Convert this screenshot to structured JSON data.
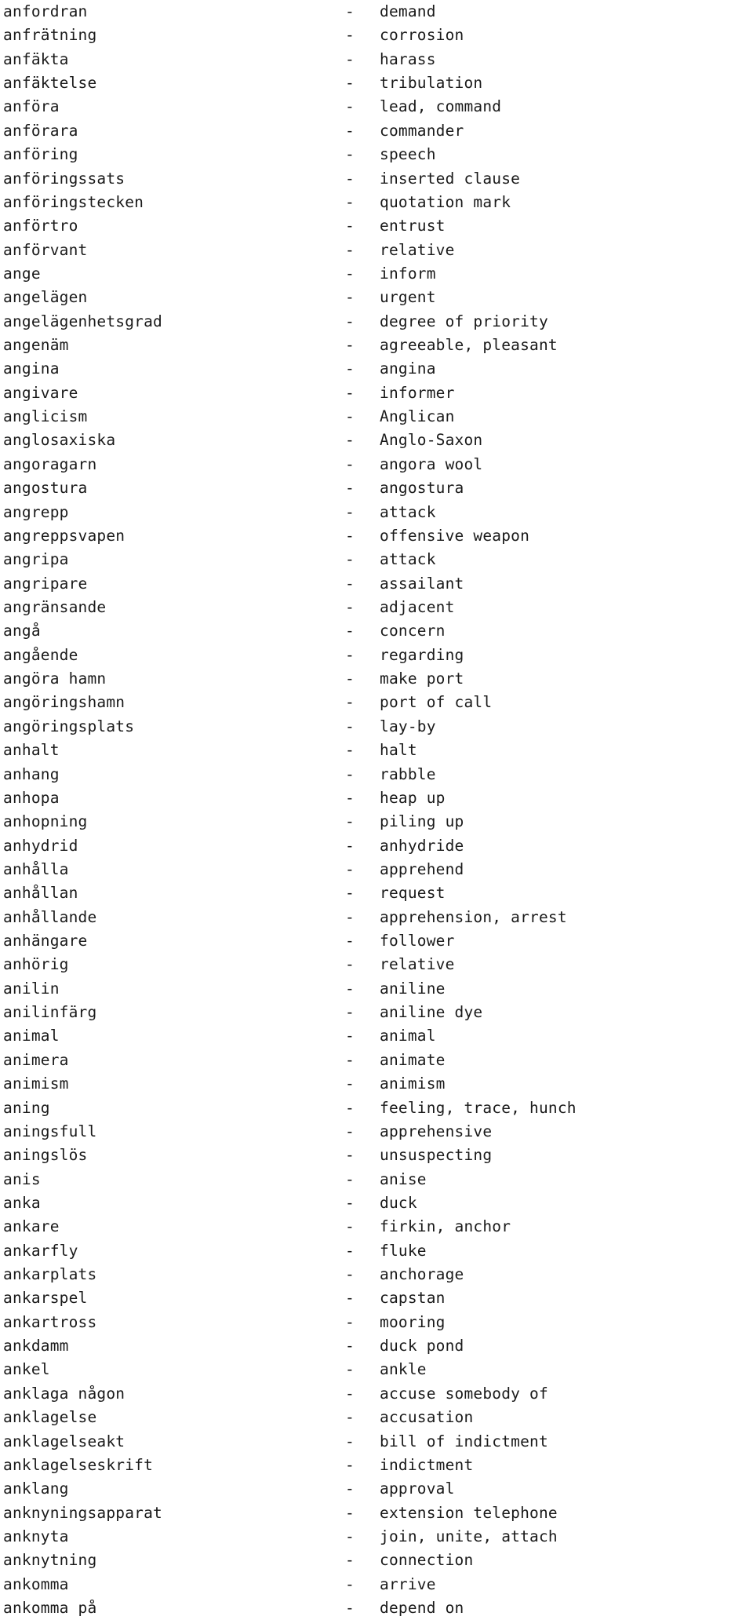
{
  "document": {
    "type": "bilingual-dictionary-page",
    "source_language": "Swedish",
    "target_language": "English",
    "separator": "-",
    "text_color": "#1a1a1a",
    "background_color": "#ffffff",
    "entries": [
      {
        "term": "anfordran",
        "gloss": "demand"
      },
      {
        "term": "anfrätning",
        "gloss": "corrosion"
      },
      {
        "term": "anfäkta",
        "gloss": "harass"
      },
      {
        "term": "anfäktelse",
        "gloss": "tribulation"
      },
      {
        "term": "anföra",
        "gloss": "lead, command"
      },
      {
        "term": "anförara",
        "gloss": "commander"
      },
      {
        "term": "anföring",
        "gloss": "speech"
      },
      {
        "term": "anföringssats",
        "gloss": "inserted clause"
      },
      {
        "term": "anföringstecken",
        "gloss": "quotation mark"
      },
      {
        "term": "anförtro",
        "gloss": "entrust"
      },
      {
        "term": "anförvant",
        "gloss": "relative"
      },
      {
        "term": "ange",
        "gloss": "inform"
      },
      {
        "term": "angelägen",
        "gloss": "urgent"
      },
      {
        "term": "angelägenhetsgrad",
        "gloss": "degree of priority"
      },
      {
        "term": "angenäm",
        "gloss": "agreeable, pleasant"
      },
      {
        "term": "angina",
        "gloss": "angina"
      },
      {
        "term": "angivare",
        "gloss": "informer"
      },
      {
        "term": "anglicism",
        "gloss": "Anglican"
      },
      {
        "term": "anglosaxiska",
        "gloss": "Anglo-Saxon"
      },
      {
        "term": "angoragarn",
        "gloss": "angora wool"
      },
      {
        "term": "angostura",
        "gloss": "angostura"
      },
      {
        "term": "angrepp",
        "gloss": "attack"
      },
      {
        "term": "angreppsvapen",
        "gloss": "offensive weapon"
      },
      {
        "term": "angripa",
        "gloss": "attack"
      },
      {
        "term": "angripare",
        "gloss": "assailant"
      },
      {
        "term": "angränsande",
        "gloss": "adjacent"
      },
      {
        "term": "angå",
        "gloss": "concern"
      },
      {
        "term": "angående",
        "gloss": "regarding"
      },
      {
        "term": "angöra hamn",
        "gloss": "make port"
      },
      {
        "term": "angöringshamn",
        "gloss": "port of call"
      },
      {
        "term": "angöringsplats",
        "gloss": "lay-by"
      },
      {
        "term": "anhalt",
        "gloss": "halt"
      },
      {
        "term": "anhang",
        "gloss": "rabble"
      },
      {
        "term": "anhopa",
        "gloss": "heap up"
      },
      {
        "term": "anhopning",
        "gloss": "piling up"
      },
      {
        "term": "anhydrid",
        "gloss": "anhydride"
      },
      {
        "term": "anhålla",
        "gloss": "apprehend"
      },
      {
        "term": "anhållan",
        "gloss": "request"
      },
      {
        "term": "anhållande",
        "gloss": "apprehension, arrest"
      },
      {
        "term": "anhängare",
        "gloss": "follower"
      },
      {
        "term": "anhörig",
        "gloss": "relative"
      },
      {
        "term": "anilin",
        "gloss": "aniline"
      },
      {
        "term": "anilinfärg",
        "gloss": "aniline dye"
      },
      {
        "term": "animal",
        "gloss": "animal"
      },
      {
        "term": "animera",
        "gloss": "animate"
      },
      {
        "term": "animism",
        "gloss": "animism"
      },
      {
        "term": "aning",
        "gloss": "feeling, trace, hunch"
      },
      {
        "term": "aningsfull",
        "gloss": "apprehensive"
      },
      {
        "term": "aningslös",
        "gloss": "unsuspecting"
      },
      {
        "term": "anis",
        "gloss": "anise"
      },
      {
        "term": "anka",
        "gloss": "duck"
      },
      {
        "term": "ankare",
        "gloss": "firkin, anchor"
      },
      {
        "term": "ankarfly",
        "gloss": "fluke"
      },
      {
        "term": "ankarplats",
        "gloss": "anchorage"
      },
      {
        "term": "ankarspel",
        "gloss": "capstan"
      },
      {
        "term": "ankartross",
        "gloss": "mooring"
      },
      {
        "term": "ankdamm",
        "gloss": "duck pond"
      },
      {
        "term": "ankel",
        "gloss": "ankle"
      },
      {
        "term": "anklaga någon",
        "gloss": "accuse somebody of"
      },
      {
        "term": "anklagelse",
        "gloss": "accusation"
      },
      {
        "term": "anklagelseakt",
        "gloss": "bill of indictment"
      },
      {
        "term": "anklagelseskrift",
        "gloss": "indictment"
      },
      {
        "term": "anklang",
        "gloss": "approval"
      },
      {
        "term": "anknyningsapparat",
        "gloss": "extension telephone"
      },
      {
        "term": "anknyta",
        "gloss": "join, unite, attach"
      },
      {
        "term": "anknytning",
        "gloss": "connection"
      },
      {
        "term": "ankomma",
        "gloss": "arrive"
      },
      {
        "term": "ankomma på",
        "gloss": "depend on"
      }
    ]
  }
}
